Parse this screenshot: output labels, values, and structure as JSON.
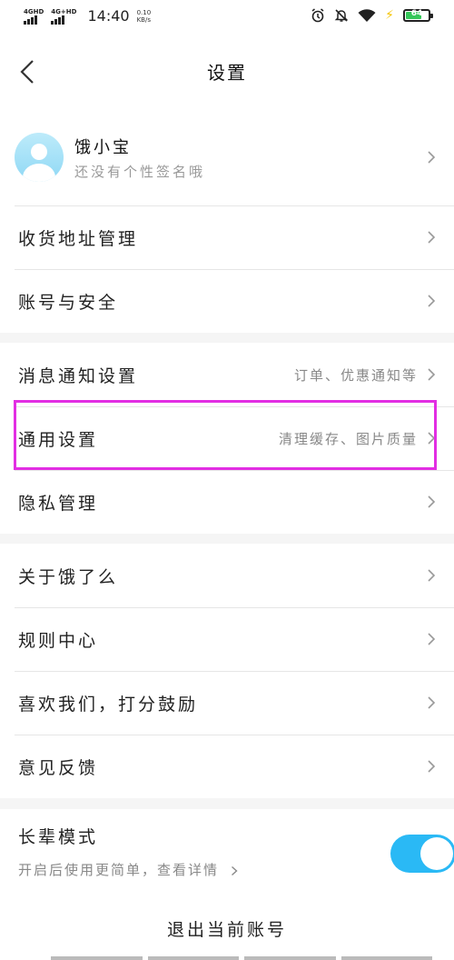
{
  "status_bar": {
    "sim1": "4GHD",
    "sim2": "4G+HD",
    "time": "14:40",
    "speed_value": "0.10",
    "speed_unit": "KB/s",
    "battery_level": "64",
    "icons": [
      "alarm-icon",
      "mute-icon",
      "wifi-icon",
      "charging-icon",
      "battery-icon"
    ]
  },
  "header": {
    "title": "设置"
  },
  "profile": {
    "name": "饿小宝",
    "signature": "还没有个性签名哦"
  },
  "section1": [
    {
      "label": "收货地址管理",
      "sub": ""
    },
    {
      "label": "账号与安全",
      "sub": ""
    }
  ],
  "section2": [
    {
      "label": "消息通知设置",
      "sub": "订单、优惠通知等"
    },
    {
      "label": "通用设置",
      "sub": "清理缓存、图片质量"
    },
    {
      "label": "隐私管理",
      "sub": ""
    }
  ],
  "section3": [
    {
      "label": "关于饿了么",
      "sub": ""
    },
    {
      "label": "规则中心",
      "sub": ""
    },
    {
      "label": "喜欢我们，打分鼓励",
      "sub": ""
    },
    {
      "label": "意见反馈",
      "sub": ""
    }
  ],
  "elder_mode": {
    "title": "长辈模式",
    "description": "开启后使用更简单，查看详情",
    "enabled": true
  },
  "logout": {
    "label": "退出当前账号"
  },
  "colors": {
    "accent": "#2ab9f5",
    "highlight": "#e22ee3",
    "background": "#f5f5f5"
  }
}
